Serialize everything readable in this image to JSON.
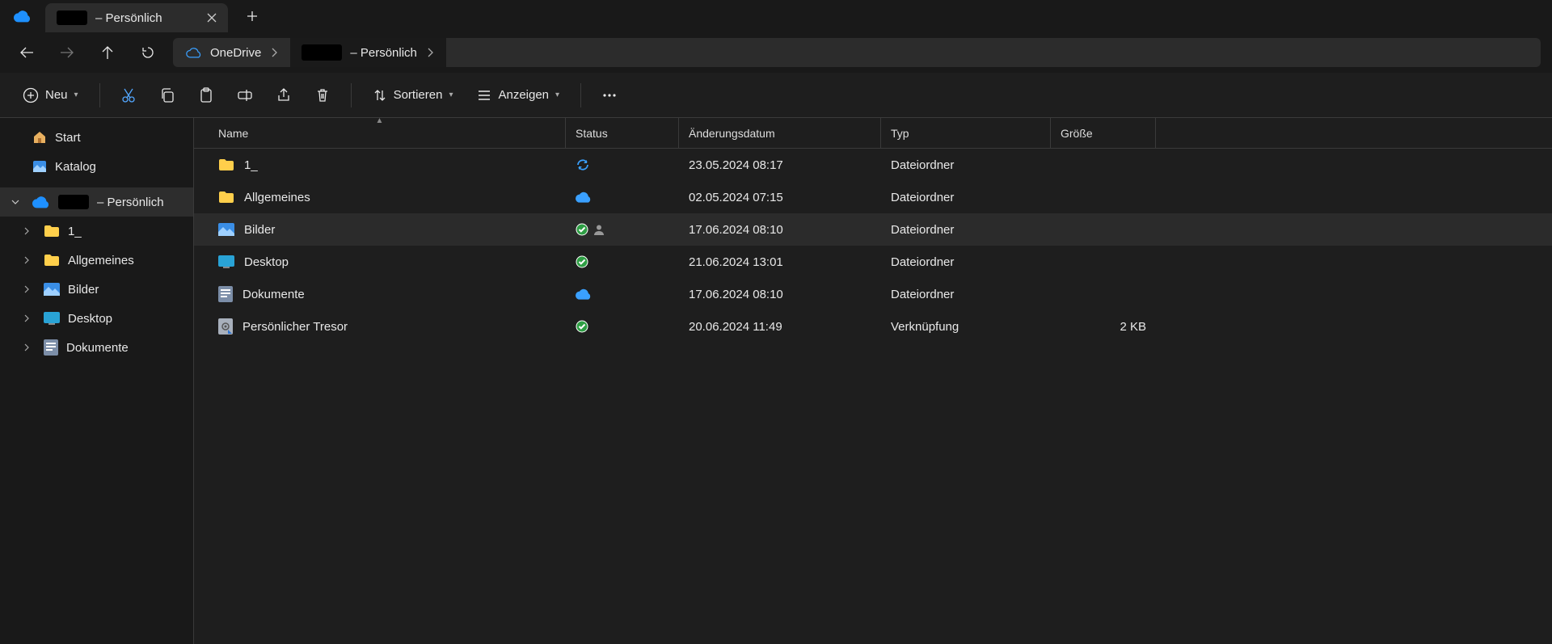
{
  "tab": {
    "title_suffix": "– Persönlich"
  },
  "breadcrumb": {
    "root": "OneDrive",
    "item_suffix": "– Persönlich"
  },
  "toolbar": {
    "new": "Neu",
    "sort": "Sortieren",
    "view": "Anzeigen"
  },
  "sidebar": {
    "start": "Start",
    "gallery": "Katalog",
    "root_suffix": "– Persönlich",
    "children": [
      {
        "label": "1_"
      },
      {
        "label": "Allgemeines"
      },
      {
        "label": "Bilder"
      },
      {
        "label": "Desktop"
      },
      {
        "label": "Dokumente"
      }
    ]
  },
  "columns": {
    "name": "Name",
    "status": "Status",
    "date": "Änderungsdatum",
    "type": "Typ",
    "size": "Größe"
  },
  "rows": [
    {
      "icon": "folder",
      "name": "1_",
      "status": [
        "sync"
      ],
      "date": "23.05.2024 08:17",
      "type": "Dateiordner",
      "size": ""
    },
    {
      "icon": "folder",
      "name": "Allgemeines",
      "status": [
        "cloud"
      ],
      "date": "02.05.2024 07:15",
      "type": "Dateiordner",
      "size": ""
    },
    {
      "icon": "gallery",
      "name": "Bilder",
      "status": [
        "check",
        "person"
      ],
      "date": "17.06.2024 08:10",
      "type": "Dateiordner",
      "size": "",
      "highlight": true
    },
    {
      "icon": "desktop",
      "name": "Desktop",
      "status": [
        "check"
      ],
      "date": "21.06.2024 13:01",
      "type": "Dateiordner",
      "size": ""
    },
    {
      "icon": "doc",
      "name": "Dokumente",
      "status": [
        "cloud"
      ],
      "date": "17.06.2024 08:10",
      "type": "Dateiordner",
      "size": ""
    },
    {
      "icon": "vault",
      "name": "Persönlicher Tresor",
      "status": [
        "check"
      ],
      "date": "20.06.2024 11:49",
      "type": "Verknüpfung",
      "size": "2 KB"
    }
  ]
}
